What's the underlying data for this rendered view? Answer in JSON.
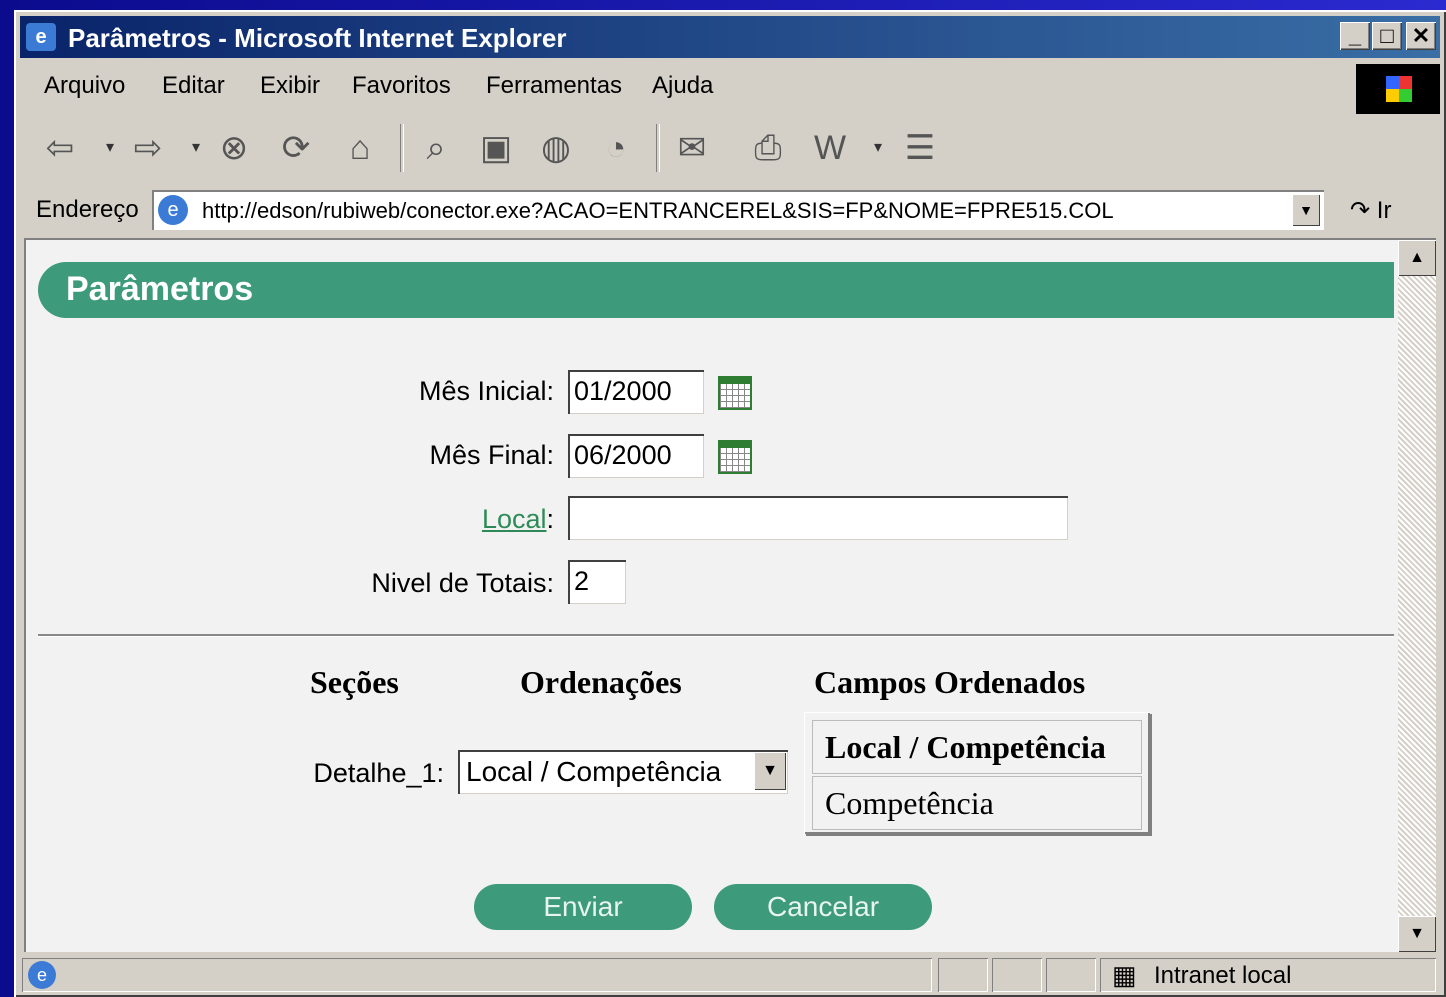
{
  "window": {
    "title": "Parâmetros - Microsoft Internet Explorer",
    "minimize": "_",
    "maximize": "□",
    "close": "✕"
  },
  "menu": {
    "items": [
      {
        "label": "Arquivo"
      },
      {
        "label": "Editar"
      },
      {
        "label": "Exibir"
      },
      {
        "label": "Favoritos"
      },
      {
        "label": "Ferramentas"
      },
      {
        "label": "Ajuda"
      }
    ]
  },
  "toolbar": {
    "icons": [
      "back-icon",
      "dropdown-icon",
      "forward-icon",
      "dropdown-icon",
      "stop-icon",
      "refresh-icon",
      "home-icon",
      "search-icon",
      "favorites-icon",
      "history-icon",
      "channels-icon",
      "mail-icon",
      "print-icon",
      "word-icon",
      "dropdown-icon",
      "discuss-icon"
    ]
  },
  "address": {
    "label": "Endereço",
    "url": "http://edson/rubiweb/conector.exe?ACAO=ENTRANCEREL&SIS=FP&NOME=FPRE515.COL",
    "go": "Ir"
  },
  "page": {
    "banner": "Parâmetros",
    "fields": {
      "mes_inicial_label": "Mês Inicial:",
      "mes_inicial_value": "01/2000",
      "mes_final_label": "Mês Final:",
      "mes_final_value": "06/2000",
      "local_label": "Local",
      "local_colon": ":",
      "local_value": "",
      "nivel_label": "Nivel de Totais:",
      "nivel_value": "2"
    },
    "columns": {
      "secoes": "Seções",
      "ordenacoes": "Ordenações",
      "campos": "Campos Ordenados"
    },
    "detalhe_label": "Detalhe_1:",
    "ordenacao_selected": "Local / Competência",
    "campos_ordenados": [
      "Local / Competência",
      "Competência"
    ],
    "buttons": {
      "enviar": "Enviar",
      "cancelar": "Cancelar"
    }
  },
  "status": {
    "zone": "Intranet local"
  },
  "colors": {
    "accent": "#3d9a7a",
    "titlebar": "#0a246a",
    "chrome": "#d4d0c8"
  }
}
